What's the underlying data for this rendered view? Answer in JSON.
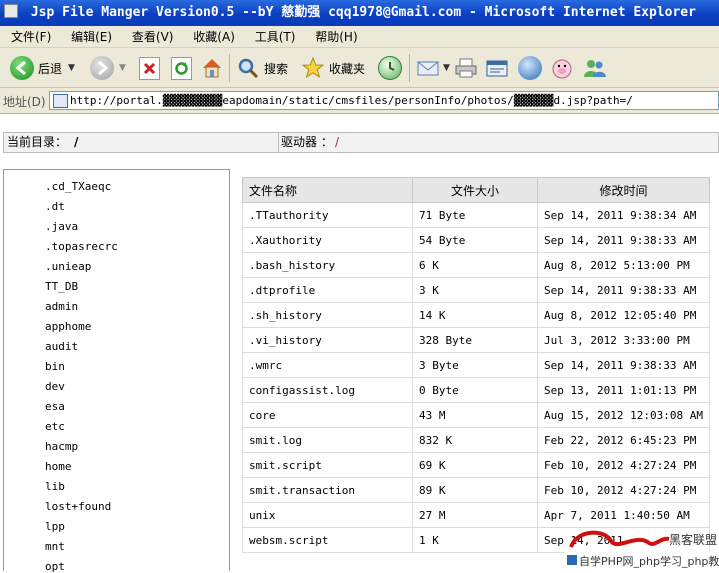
{
  "window": {
    "title": "Jsp File Manger Version0.5 --bY 慈勤强 cqq1978@Gmail.com - Microsoft Internet Explorer"
  },
  "menu": [
    "文件(F)",
    "编辑(E)",
    "查看(V)",
    "收藏(A)",
    "工具(T)",
    "帮助(H)"
  ],
  "toolbar": {
    "back_label": "后退",
    "search_label": "搜索",
    "favorites_label": "收藏夹"
  },
  "address": {
    "label": "地址(D)",
    "url": "http://portal.▓▓▓▓▓▓▓▓▓eapdomain/static/cmsfiles/personInfo/photos/▓▓▓▓▓▓d.jsp?path=/"
  },
  "location": {
    "current_dir_label": "当前目录：",
    "current_dir_value": "/",
    "drive_label": "驱动器 ：",
    "drive_value": "/"
  },
  "directories": [
    ".cd_TXaeqc",
    ".dt",
    ".java",
    ".topasrecrc",
    ".unieap",
    "TT_DB",
    "admin",
    "apphome",
    "audit",
    "bin",
    "dev",
    "esa",
    "etc",
    "hacmp",
    "home",
    "lib",
    "lost+found",
    "lpp",
    "mnt",
    "opt"
  ],
  "file_table": {
    "headers": [
      "文件名称",
      "文件大小",
      "修改时间"
    ],
    "rows": [
      [
        ".TTauthority",
        "71 Byte",
        "Sep 14, 2011 9:38:34 AM"
      ],
      [
        ".Xauthority",
        "54 Byte",
        "Sep 14, 2011 9:38:33 AM"
      ],
      [
        ".bash_history",
        "6 K",
        "Aug 8, 2012 5:13:00 PM"
      ],
      [
        ".dtprofile",
        "3 K",
        "Sep 14, 2011 9:38:33 AM"
      ],
      [
        ".sh_history",
        "14 K",
        "Aug 8, 2012 12:05:40 PM"
      ],
      [
        ".vi_history",
        "328 Byte",
        "Jul 3, 2012 3:33:00 PM"
      ],
      [
        ".wmrc",
        "3 Byte",
        "Sep 14, 2011 9:38:33 AM"
      ],
      [
        "configassist.log",
        "0 Byte",
        "Sep 13, 2011 1:01:13 PM"
      ],
      [
        "core",
        "43 M",
        "Aug 15, 2012 12:03:08 AM"
      ],
      [
        "smit.log",
        "832 K",
        "Feb 22, 2012 6:45:23 PM"
      ],
      [
        "smit.script",
        "69 K",
        "Feb 10, 2012 4:27:24 PM"
      ],
      [
        "smit.transaction",
        "89 K",
        "Feb 10, 2012 4:27:24 PM"
      ],
      [
        "unix",
        "27 M",
        "Apr 7, 2011 1:40:50 AM"
      ],
      [
        "websm.script",
        "1 K",
        "Sep 14, 2011"
      ]
    ]
  },
  "watermark": {
    "logo_text": "黑客联盟",
    "footer_text": "自学PHP网_php学习_php教"
  }
}
